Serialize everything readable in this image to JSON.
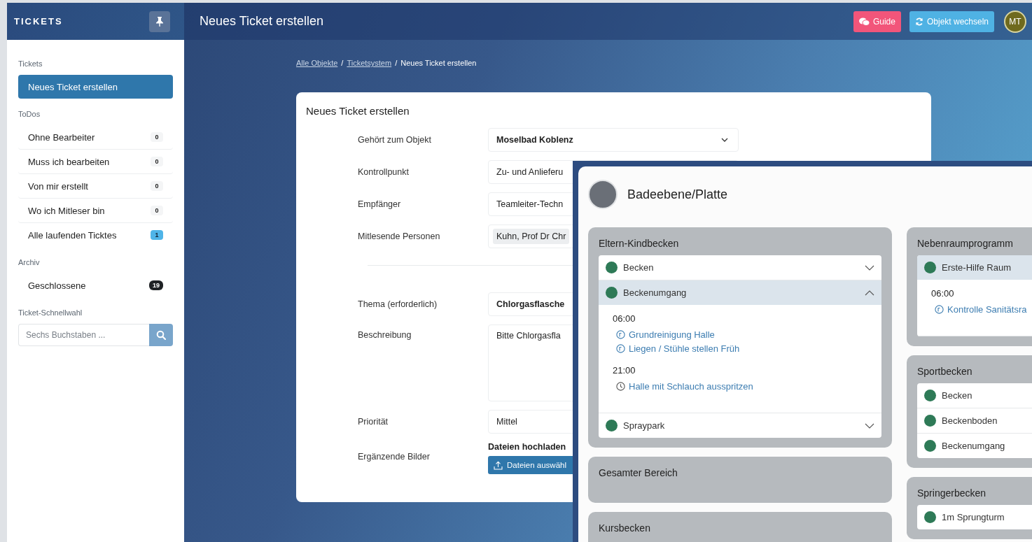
{
  "sidebar": {
    "brand": "TICKETS",
    "sections": [
      {
        "title": "Tickets",
        "items": [
          {
            "label": "Neues Ticket erstellen",
            "selected": true
          }
        ]
      },
      {
        "title": "ToDos",
        "items": [
          {
            "label": "Ohne Bearbeiter",
            "count": "0",
            "kind": "muted",
            "selected": false
          },
          {
            "label": "Muss ich bearbeiten",
            "count": "0",
            "kind": "muted",
            "selected": false
          },
          {
            "label": "Von mir erstellt",
            "count": "0",
            "kind": "muted",
            "selected": false
          },
          {
            "label": "Wo ich Mitleser bin",
            "count": "0",
            "kind": "muted",
            "selected": false
          },
          {
            "label": "Alle laufenden Ticktes",
            "count": "1",
            "kind": "info",
            "selected": false
          }
        ]
      },
      {
        "title": "Archiv",
        "items": [
          {
            "label": "Geschlossene",
            "count": "19",
            "kind": "dark",
            "selected": false
          }
        ]
      }
    ],
    "quick_select": {
      "title": "Ticket-Schnellwahl",
      "placeholder": "Sechs Buchstaben ..."
    }
  },
  "header": {
    "title": "Neues Ticket erstellen",
    "buttons": [
      {
        "label": "Guide",
        "kind": "guide"
      },
      {
        "label": "Objekt wechseln",
        "kind": "switch"
      }
    ],
    "avatar": "MT"
  },
  "breadcrumb": [
    {
      "label": "Alle Objekte",
      "link": true
    },
    {
      "separator": "/",
      "label": "Ticketsystem",
      "link": true
    },
    {
      "separator": "/",
      "label": "Neues Ticket erstellen",
      "link": false
    }
  ],
  "form": {
    "title": "Neues Ticket erstellen",
    "groups": [
      [
        {
          "label": "Gehört zum Objekt",
          "kind": "select",
          "value": "Moselbad Koblenz",
          "bold": true
        },
        {
          "label": "Kontrollpunkt",
          "kind": "text",
          "value": "Zu- und Anlieferu",
          "bold": false
        },
        {
          "label": "Empfänger",
          "kind": "text",
          "value": "Teamleiter-Techn",
          "bold": false
        },
        {
          "label": "Mitlesende Personen",
          "kind": "tags",
          "value": "Kuhn, Prof Dr Chr",
          "bold": false
        }
      ],
      [
        {
          "label": "Thema (erforderlich)",
          "kind": "text",
          "value": "Chlorgasflasche",
          "bold": true
        },
        {
          "label": "Beschreibung",
          "kind": "textarea",
          "value": "Bitte Chlorgasfla",
          "bold": false
        },
        {
          "label": "Priorität",
          "kind": "text",
          "value": "Mittel",
          "bold": false
        },
        {
          "label": "Ergänzende Bilder",
          "kind": "upload",
          "value": "Dateien hochladen",
          "button": "Dateien auswähl",
          "bold": true
        }
      ]
    ]
  },
  "overlay": {
    "title": "Badeebene/Platte",
    "columns": [
      [
        {
          "title": "Eltern-Kindbecken",
          "rows": [
            {
              "label": "Becken",
              "color": "#2e7a57",
              "expanded": false
            },
            {
              "label": "Beckenumgang",
              "color": "#2e7a57",
              "expanded": true,
              "schedule": [
                {
                  "time": "06:00",
                  "tasks": [
                    {
                      "label": "Grundreinigung Halle",
                      "kind": "recurring"
                    },
                    {
                      "label": "Liegen / Stühle stellen Früh",
                      "kind": "recurring"
                    }
                  ]
                },
                {
                  "time": "21:00",
                  "tasks": [
                    {
                      "label": "Halle mit Schlauch ausspritzen",
                      "kind": "clock"
                    }
                  ]
                }
              ]
            },
            {
              "label": "Spraypark",
              "color": "#2e7a57",
              "expanded": false
            }
          ]
        },
        {
          "title": "Gesamter Bereich"
        },
        {
          "title": "Kursbecken"
        }
      ],
      [
        {
          "title": "Nebenraumprogramm",
          "rows": [
            {
              "label": "Erste-Hilfe Raum",
              "color": "#2e7a57",
              "expanded": true,
              "schedule": [
                {
                  "time": "06:00",
                  "tasks": [
                    {
                      "label": "Kontrolle Sanitätsra",
                      "kind": "recurring"
                    }
                  ]
                }
              ]
            }
          ]
        },
        {
          "title": "Sportbecken",
          "rows": [
            {
              "label": "Becken",
              "color": "#2e7a57",
              "expanded": false
            },
            {
              "label": "Beckenboden",
              "color": "#2e7a57",
              "expanded": false
            },
            {
              "label": "Beckenumgang",
              "color": "#2e7a57",
              "expanded": false
            }
          ]
        },
        {
          "title": "Springerbecken",
          "rows": [
            {
              "label": "1m Sprungturm",
              "color": "#2e7a57",
              "expanded": false
            }
          ]
        }
      ]
    ]
  }
}
